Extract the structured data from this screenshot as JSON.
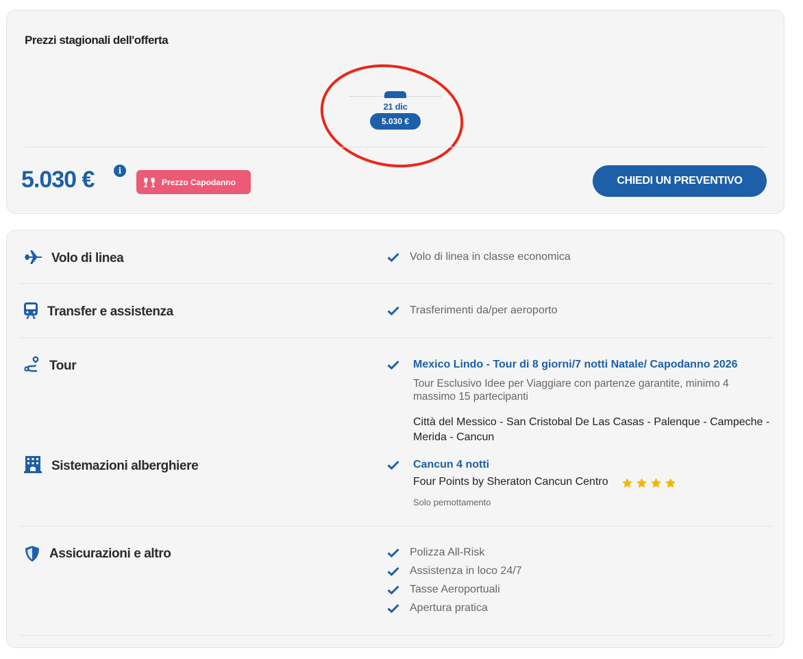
{
  "prices": {
    "title": "Prezzi stagionali dell'offerta",
    "calendar": {
      "date": "21 dic",
      "price": "5.030 €"
    },
    "price": "5.030 €",
    "info_icon": "info-icon",
    "badge": {
      "icon": "champagne-glasses-icon",
      "label": "Prezzo Capodanno"
    },
    "cta_label": "CHIEDI UN PREVENTIVO"
  },
  "features": {
    "flight": {
      "icon": "plane-icon",
      "label": "Volo di linea",
      "text": "Volo di linea in classe economica"
    },
    "transfer": {
      "icon": "train-icon",
      "label": "Transfer e assistenza",
      "text": "Trasferimenti da/per aeroporto"
    },
    "tour": {
      "icon": "route-icon",
      "label": "Tour",
      "link": "Mexico Lindo - Tour di 8 giorni/7 notti Natale/ Capodanno 2026",
      "description": "Tour Esclusivo Idee per Viaggiare con partenze garantite, minimo 4 massimo 15 partecipanti",
      "route": "Città del Messico - San Cristobal De Las Casas - Palenque - Campeche - Merida - Cancun"
    },
    "hotel": {
      "icon": "hotel-icon",
      "label": "Sistemazioni alberghiere",
      "link": "Cancun 4 notti",
      "name": "Four Points by Sheraton Cancun Centro",
      "stars": 4,
      "board": "Solo pernottamento"
    },
    "insurance": {
      "icon": "shield-icon",
      "label": "Assicurazioni e altro",
      "items": [
        "Polizza All-Risk",
        "Assistenza in loco 24/7",
        "Tasse Aeroportuali",
        "Apertura pratica"
      ]
    }
  },
  "colors": {
    "primary": "#1d5fa8",
    "badge": "#ec5a75",
    "annotation": "#e8291c",
    "star": "#f5b400"
  }
}
